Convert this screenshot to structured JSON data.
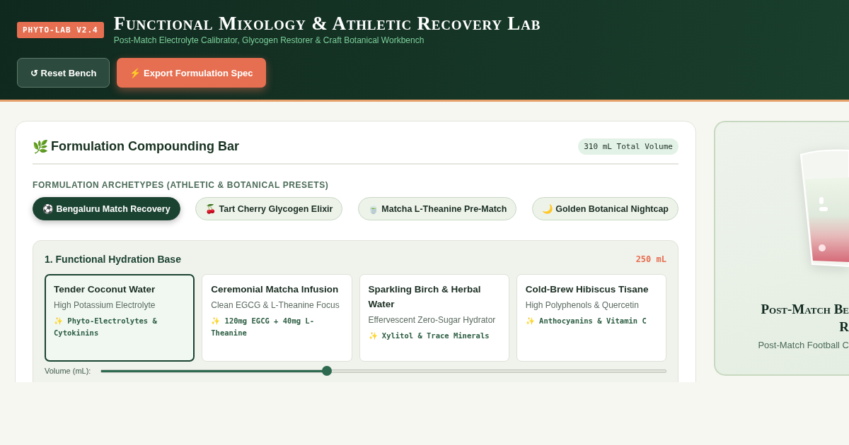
{
  "header": {
    "badge": "PHYTO-LAB V2.4",
    "title": "Functional Mixology & Athletic Recovery Lab",
    "subtitle": "Post-Match Electrolyte Calibrator, Glycogen Restorer & Craft Botanical Workbench",
    "buttons": [
      {
        "label": "↺ Reset Bench",
        "kind": "secondary"
      },
      {
        "label": "⚡ Export Formulation Spec",
        "kind": "primary"
      }
    ]
  },
  "bar": {
    "icon": "🌿",
    "title": "Formulation Compounding Bar",
    "total": "310 mL Total Volume",
    "archetypes_label": "FORMULATION ARCHETYPES (ATHLETIC & BOTANICAL PRESETS)",
    "presets": [
      {
        "label": "⚽ Bengaluru Match Recovery",
        "selected": true
      },
      {
        "label": "🍒 Tart Cherry Glycogen Elixir",
        "selected": false
      },
      {
        "label": "🍵 Matcha L-Theanine Pre-Match",
        "selected": false
      },
      {
        "label": "🌙 Golden Botanical Nightcap",
        "selected": false
      }
    ],
    "section": {
      "title": "1. Functional Hydration Base",
      "amount": "250 mL",
      "options": [
        {
          "name": "Tender Coconut Water",
          "desc": "High Potassium Electrolyte",
          "note": "✨ Phyto-Electrolytes & Cytokinins",
          "selected": true
        },
        {
          "name": "Ceremonial Matcha Infusion",
          "desc": "Clean EGCG & L-Theanine Focus",
          "note": "✨ 120mg EGCG + 40mg L-Theanine",
          "selected": false
        },
        {
          "name": "Sparkling Birch & Herbal Water",
          "desc": "Effervescent Zero-Sugar Hydrator",
          "note": "✨ Xylitol & Trace Minerals",
          "selected": false
        },
        {
          "name": "Cold-Brew Hibiscus Tisane",
          "desc": "High Polyphenols & Quercetin",
          "note": "✨ Anthocyanins & Vitamin C",
          "selected": false
        }
      ],
      "volume_label": "Volume (mL):",
      "volume": {
        "level": 0.4
      }
    }
  },
  "preview": {
    "title_lines": [
      "Post-Match Be",
      "R"
    ],
    "subtitle": "Post-Match Football C"
  }
}
